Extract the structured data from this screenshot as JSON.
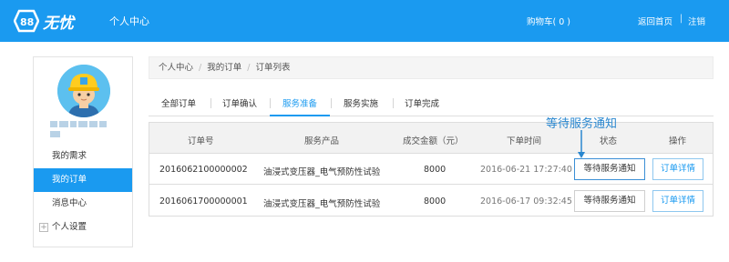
{
  "header": {
    "logo_text": "88无忧",
    "title": "个人中心",
    "cart_label": "购物车",
    "cart_count": "( 0 )",
    "home_link": "返回首页",
    "separator": "|",
    "logout": "注销"
  },
  "sidebar": {
    "items": [
      {
        "label": "我的需求"
      },
      {
        "label": "我的订单"
      },
      {
        "label": "消息中心"
      },
      {
        "label": "个人设置"
      }
    ]
  },
  "breadcrumb": [
    "个人中心",
    "我的订单",
    "订单列表"
  ],
  "breadcrumb_sep": "/",
  "tabs": [
    "全部订单",
    "订单确认",
    "服务准备",
    "服务实施",
    "订单完成"
  ],
  "active_tab": "服务准备",
  "annotation": "等待服务通知",
  "table": {
    "headers": [
      "订单号",
      "服务产品",
      "成交金额（元）",
      "下单时间",
      "状态",
      "操作"
    ],
    "rows": [
      {
        "order_no": "2016062100000002",
        "product": "油浸式变压器_电气预防性试验",
        "amount": "8000",
        "time": "2016-06-21 17:27:40",
        "status": "等待服务通知",
        "action": "订单详情"
      },
      {
        "order_no": "2016061700000001",
        "product": "油浸式变压器_电气预防性试验",
        "amount": "8000",
        "time": "2016-06-17 09:32:45",
        "status": "等待服务通知",
        "action": "订单详情"
      }
    ]
  },
  "colors": {
    "brand": "#1a9af0",
    "annotation": "#2a87cf"
  }
}
